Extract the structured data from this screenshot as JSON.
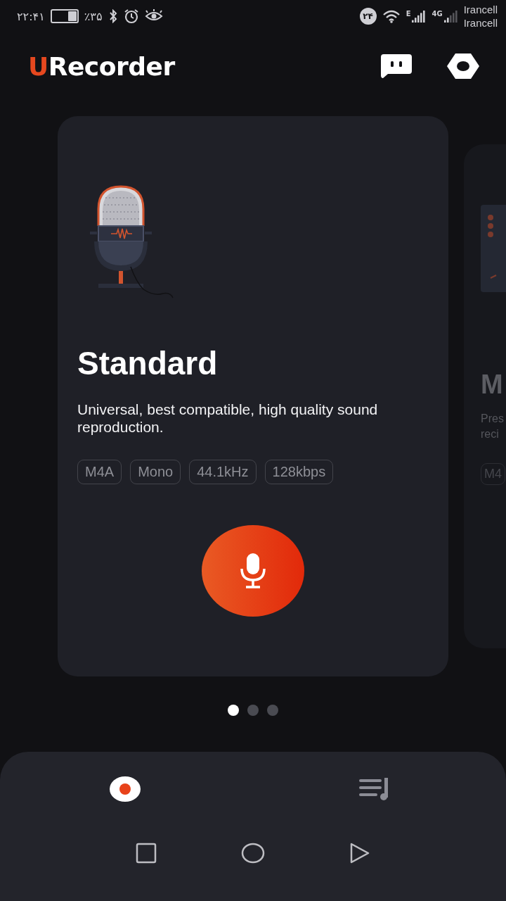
{
  "status_bar": {
    "time": "۲۲:۴۱",
    "battery_percent": "٪۳۵",
    "notification_badge": "۲۴",
    "network_1": "E",
    "network_2": "4G",
    "carriers": [
      "Irancell",
      "Irancell"
    ]
  },
  "header": {
    "logo": {
      "accent": "U",
      "rest": "Recorder"
    }
  },
  "cards": [
    {
      "selected": true,
      "title": "Standard",
      "description": "Universal, best compatible, high quality sound reproduction.",
      "tags": [
        "M4A",
        "Mono",
        "44.1kHz",
        "128kbps"
      ]
    },
    {
      "selected": false,
      "title": "M",
      "description_lines": [
        "Pres",
        "reci"
      ],
      "tags": [
        "M4"
      ]
    }
  ],
  "pager": [
    {
      "selected": true
    },
    {
      "selected": false
    },
    {
      "selected": false
    }
  ],
  "bottom_tabs": [
    {
      "kind": "record",
      "selected": true
    },
    {
      "kind": "playlist",
      "selected": false
    }
  ]
}
